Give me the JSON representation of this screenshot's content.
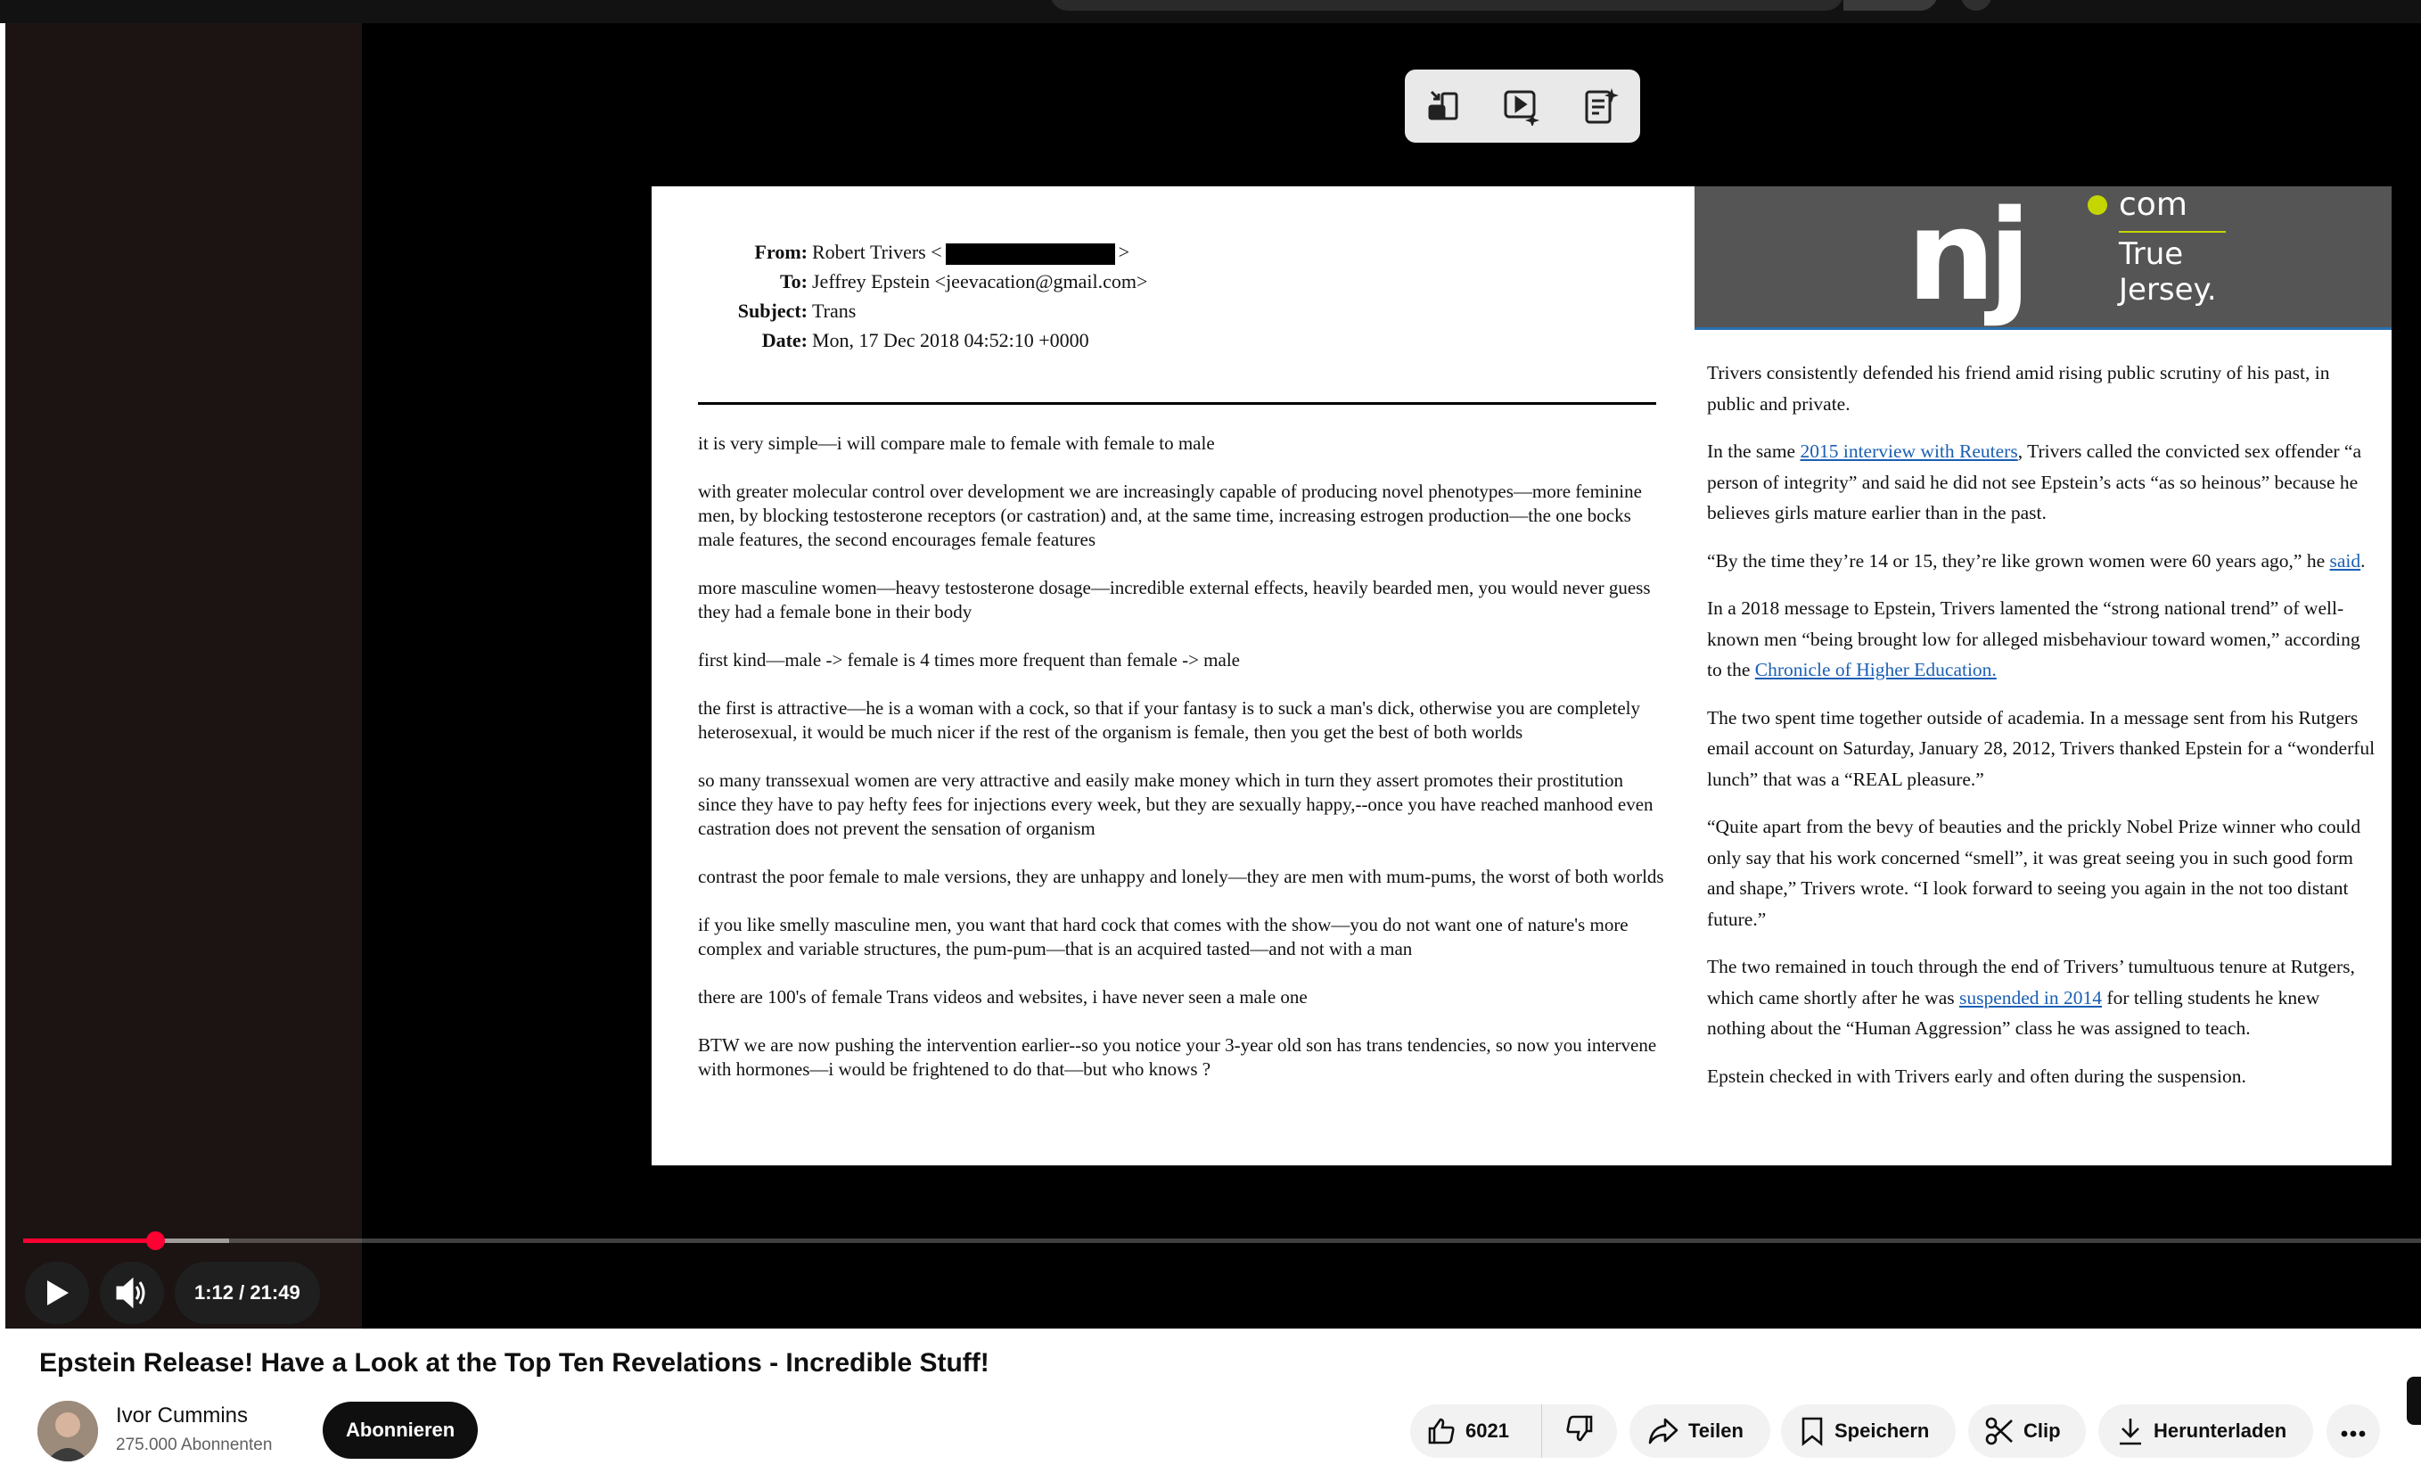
{
  "video": {
    "title": "Epstein Release! Have a Look at the Top Ten Revelations - Incredible Stuff!",
    "time_current": "1:12",
    "time_separator": "/",
    "time_total": "21:49",
    "progress_played_fraction": 0.055,
    "progress_buffered_fraction": 0.086
  },
  "channel": {
    "name": "Ivor Cummins",
    "subscribers": "275.000 Abonnenten",
    "subscribe_label": "Abonnieren"
  },
  "actions": {
    "like_count": "6021",
    "share_label": "Teilen",
    "save_label": "Speichern",
    "clip_label": "Clip",
    "download_label": "Herunterladen"
  },
  "email": {
    "labels": [
      "From:",
      "To:",
      "Subject:",
      "Date:"
    ],
    "from_name": "Robert Trivers <",
    "from_end": ">",
    "to": "Jeffrey Epstein <jeevacation@gmail.com>",
    "subject": "Trans",
    "date": "Mon, 17 Dec 2018 04:52:10 +0000",
    "paragraphs": [
      "it is very simple—i will compare male to female with female to male",
      "with greater molecular control over development we are increasingly capable of producing novel phenotypes—more feminine men, by blocking testosterone receptors (or castration) and, at the same time, increasing estrogen production—the one bocks male features, the second encourages female features",
      "more masculine women—heavy testosterone dosage—incredible external effects, heavily bearded men, you would never guess they had a female bone in their body",
      "first kind—male -> female is 4 times more frequent than female -> male",
      "the first is attractive—he is a woman with a cock, so that if your fantasy is to suck a man's dick, otherwise you are completely heterosexual, it would be much nicer if the rest of the organism is female, then you get the best of both worlds",
      "so many transsexual women are very attractive and easily make money which in turn they assert promotes their prostitution since they have to pay hefty fees for injections every week, but they are sexually happy,--once you have reached manhood even castration does not prevent the sensation of organism",
      "contrast the poor female to male versions, they are unhappy and lonely—they are men with mum-pums, the worst of both worlds",
      "if you like smelly masculine men, you want that hard cock that comes with the show—you do not want one of nature's more complex and variable structures, the pum-pum—that is an acquired tasted—and not with a man",
      "there are 100's of female Trans videos and websites, i have never seen a male one",
      "BTW we are now pushing the intervention earlier--so you notice your 3-year old son has trans tendencies, so now you intervene with hormones—i would be frightened to do that—but who knows ?"
    ]
  },
  "article": {
    "logo_letters": "nj",
    "logo_com": "com",
    "logo_tag_1": "True",
    "logo_tag_2": "Jersey.",
    "p1": "Trivers consistently defended his friend amid rising public scrutiny of his past, in public and private.",
    "p2_a": "In the same ",
    "p2_link": "2015 interview with Reuters",
    "p2_b": ", Trivers called the convicted sex offender “a person of integrity” and said he did not see Epstein’s acts “as so heinous” because he believes girls mature earlier than in the past.",
    "p3_a": "“By the time they’re 14 or 15, they’re like grown women were 60 years ago,” he ",
    "p3_link": "said",
    "p3_b": ".",
    "p4_a": "In a 2018 message to Epstein, Trivers lamented the “strong national trend” of well-known men “being brought low for alleged misbehaviour toward women,” according to the ",
    "p4_link": "Chronicle of Higher Education.",
    "p5": "The two spent time together outside of academia. In a message sent from his Rutgers email account on Saturday, January 28, 2012, Trivers thanked Epstein for a “wonderful lunch” that was a “REAL pleasure.”",
    "p6": "“Quite apart from the bevy of beauties and the prickly Nobel Prize winner who could only say that his work concerned “smell”, it was great seeing you in such good form and shape,” Trivers wrote. “I look forward to seeing you again in the not too distant future.”",
    "p7_a": "The two remained in touch through the end of Trivers’ tumultuous tenure at Rutgers, which came shortly after he was ",
    "p7_link": "suspended in 2014",
    "p7_b": " for telling students he knew nothing about the “Human Aggression” class he was assigned to teach.",
    "p8": "Epstein checked in with Trivers early and often during the suspension."
  },
  "colors": {
    "progress_played": "#ff0033",
    "player_background": "#000000",
    "left_pane": "#1b1413",
    "link_blue": "#1a5fb4",
    "logo_accent": "#c4d600"
  },
  "icons": [
    "collapse-icon",
    "video-sparkle-icon",
    "notes-sparkle-icon",
    "play-icon",
    "volume-icon",
    "thumbs-up-icon",
    "thumbs-down-icon",
    "share-icon",
    "save-bookmark-icon",
    "scissors-icon",
    "download-icon",
    "more-icon"
  ]
}
